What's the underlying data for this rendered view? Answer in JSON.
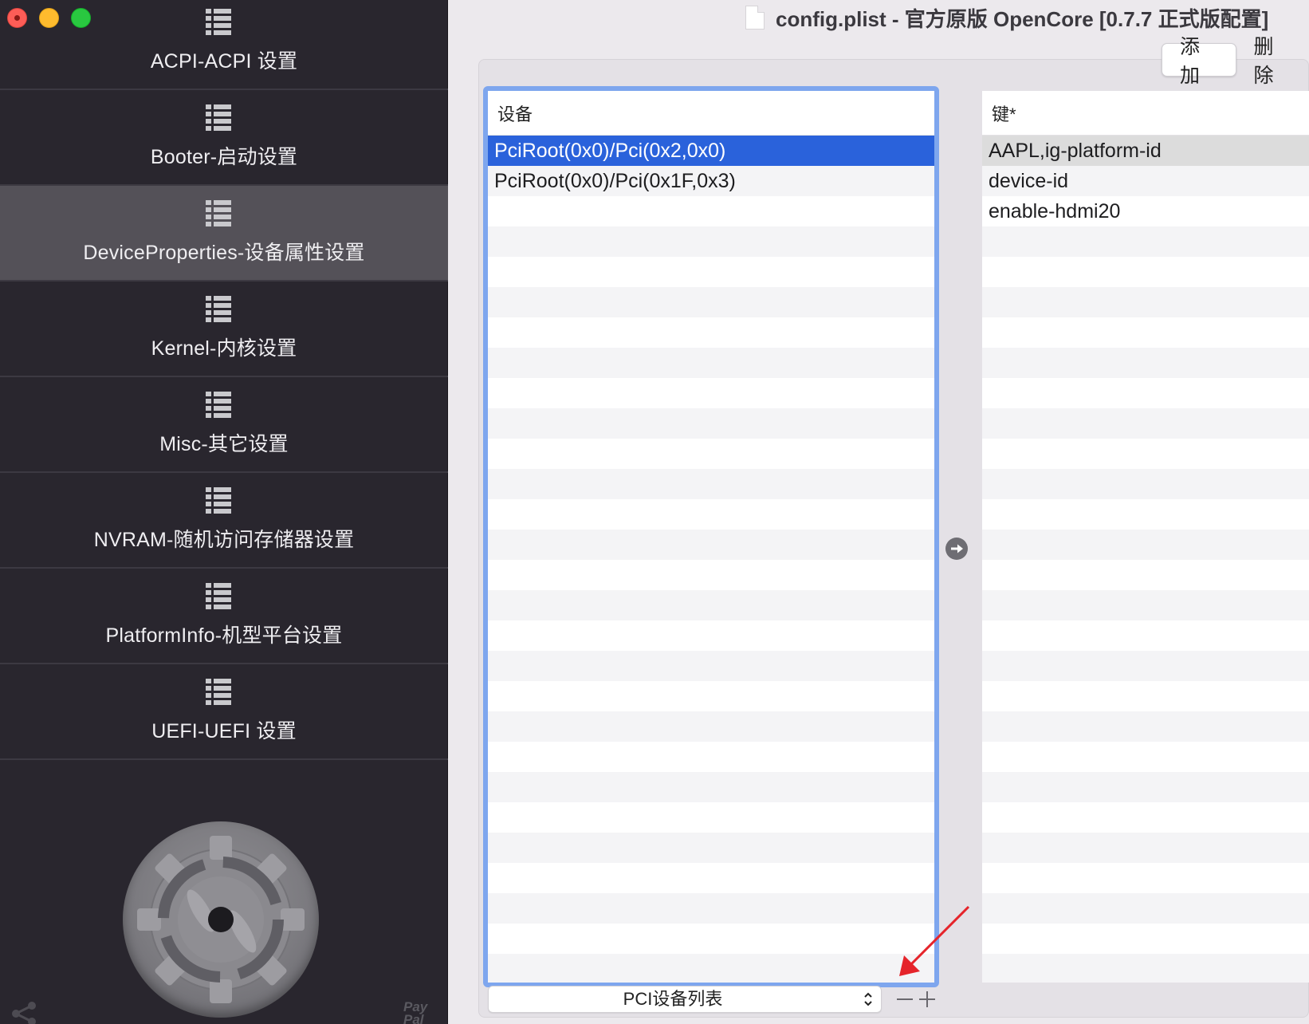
{
  "window": {
    "title": "config.plist - 官方原版 OpenCore [0.7.7 正式版配置]"
  },
  "sidebar": {
    "items": [
      {
        "label": "ACPI-ACPI 设置",
        "selected": false
      },
      {
        "label": "Booter-启动设置",
        "selected": false
      },
      {
        "label": "DeviceProperties-设备属性设置",
        "selected": true
      },
      {
        "label": "Kernel-内核设置",
        "selected": false
      },
      {
        "label": "Misc-其它设置",
        "selected": false
      },
      {
        "label": "NVRAM-随机访问存储器设置",
        "selected": false
      },
      {
        "label": "PlatformInfo-机型平台设置",
        "selected": false
      },
      {
        "label": "UEFI-UEFI 设置",
        "selected": false
      }
    ],
    "paypal_text": "Pay Pal"
  },
  "segmented": {
    "add_label": "添加",
    "delete_label": "删除",
    "active": "add"
  },
  "device_table": {
    "header": "设备",
    "rows": [
      "PciRoot(0x0)/Pci(0x2,0x0)",
      "PciRoot(0x0)/Pci(0x1F,0x3)"
    ],
    "selected_index": 0
  },
  "key_table": {
    "header": "键*",
    "rows": [
      "AAPL,ig-platform-id",
      "device-id",
      "enable-hdmi20"
    ],
    "selected_index": 0
  },
  "footer": {
    "select_value": "PCI设备列表"
  },
  "colors": {
    "accent_blue": "#2a62db",
    "focus_ring": "#7ea6ee",
    "annotation_arrow": "#e5242b",
    "sidebar_bg": "#29262e"
  },
  "icons": {
    "nav": "list-icon",
    "arrow": "arrow-right-circle-icon",
    "share": "share-icon",
    "gear": "gear-icon"
  }
}
